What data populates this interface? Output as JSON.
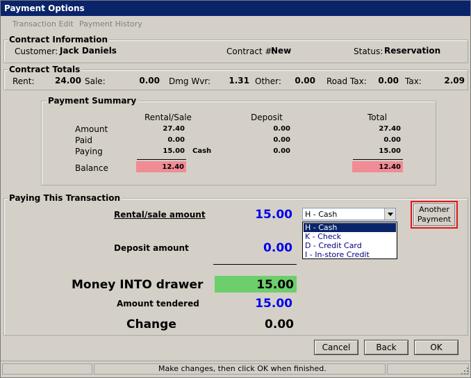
{
  "window": {
    "title": "Payment Options"
  },
  "menu": {
    "items": [
      "Transaction Edit",
      "Payment History"
    ]
  },
  "contract_info": {
    "title": "Contract Information",
    "customer_label": "Customer:",
    "customer_value": "Jack Daniels",
    "contract_label": "Contract #:",
    "contract_value": "New",
    "status_label": "Status:",
    "status_value": "Reservation"
  },
  "contract_totals": {
    "title": "Contract Totals",
    "rent_label": "Rent:",
    "rent_value": "24.00",
    "sale_label": "Sale:",
    "sale_value": "0.00",
    "dmg_label": "Dmg Wvr:",
    "dmg_value": "1.31",
    "other_label": "Other:",
    "other_value": "0.00",
    "road_label": "Road Tax:",
    "road_value": "0.00",
    "tax_label": "Tax:",
    "tax_value": "2.09"
  },
  "payment_summary": {
    "title": "Payment Summary",
    "col_rental": "Rental/Sale",
    "col_deposit": "Deposit",
    "col_total": "Total",
    "row_amount": "Amount",
    "row_paid": "Paid",
    "row_paying": "Paying",
    "row_balance": "Balance",
    "rental": {
      "amount": "27.40",
      "paid": "0.00",
      "paying": "15.00",
      "balance": "12.40"
    },
    "paying_method": "Cash",
    "deposit": {
      "amount": "0.00",
      "paid": "0.00",
      "paying": "0.00"
    },
    "total": {
      "amount": "27.40",
      "paid": "0.00",
      "paying": "15.00",
      "balance": "12.40"
    }
  },
  "paying": {
    "title": "Paying This Transaction",
    "rental_label": "Rental/sale amount",
    "rental_value": "15.00",
    "deposit_label": "Deposit amount",
    "deposit_value": "0.00",
    "money_label": "Money INTO drawer",
    "money_value": "15.00",
    "tendered_label": "Amount tendered",
    "tendered_value": "15.00",
    "change_label": "Change",
    "change_value": "0.00",
    "method_selected": "H - Cash",
    "method_options": [
      "H - Cash",
      "K - Check",
      "D - Credit Card",
      "I - In-store Credit"
    ],
    "another_payment": "Another Payment"
  },
  "buttons": {
    "cancel": "Cancel",
    "back": "Back",
    "ok": "OK"
  },
  "status": {
    "text": "Make changes, then click OK when finished."
  },
  "colors": {
    "title_bar": "#0a246a",
    "balance_highlight": "#f08c96",
    "money_highlight": "#6ccf6c",
    "amount_blue": "#0000ee",
    "another_border": "#e0181e"
  }
}
